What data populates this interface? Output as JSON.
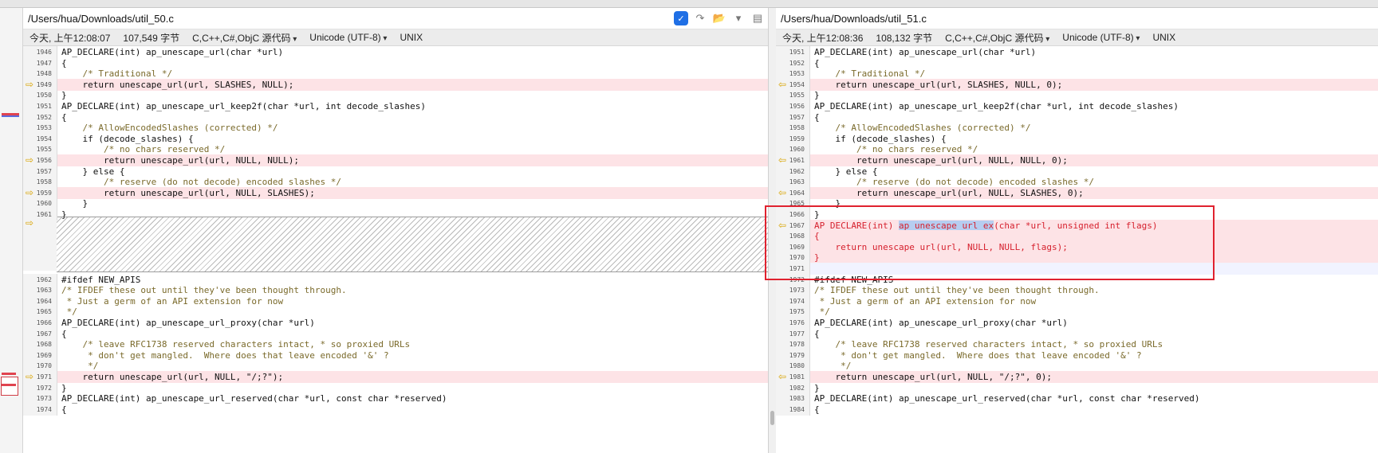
{
  "left": {
    "path": "/Users/hua/Downloads/util_50.c",
    "info": {
      "time": "今天, 上午12:08:07",
      "size": "107,549 字节",
      "syntax": "C,C++,C#,ObjC 源代码",
      "encoding": "Unicode (UTF-8)",
      "lineend": "UNIX"
    },
    "lines": [
      {
        "n": "1946",
        "t": "AP_DECLARE(int) ap_unescape_url(char *url)"
      },
      {
        "n": "1947",
        "t": "{"
      },
      {
        "n": "1948",
        "t": "    /* Traditional */"
      },
      {
        "n": "1949",
        "t": "    return unescape_url(url, SLASHES, NULL);"
      },
      {
        "n": "1950",
        "t": "}"
      },
      {
        "n": "1951",
        "t": "AP_DECLARE(int) ap_unescape_url_keep2f(char *url, int decode_slashes)"
      },
      {
        "n": "1952",
        "t": "{"
      },
      {
        "n": "1953",
        "t": "    /* AllowEncodedSlashes (corrected) */"
      },
      {
        "n": "1954",
        "t": "    if (decode_slashes) {"
      },
      {
        "n": "1955",
        "t": "        /* no chars reserved */"
      },
      {
        "n": "1956",
        "t": "        return unescape_url(url, NULL, NULL);"
      },
      {
        "n": "1957",
        "t": "    } else {"
      },
      {
        "n": "1958",
        "t": "        /* reserve (do not decode) encoded slashes */"
      },
      {
        "n": "1959",
        "t": "        return unescape_url(url, NULL, SLASHES);"
      },
      {
        "n": "1960",
        "t": "    }"
      },
      {
        "n": "1961",
        "t": "}"
      },
      {
        "n": "1962",
        "t": "#ifdef NEW_APIS"
      },
      {
        "n": "1963",
        "t": "/* IFDEF these out until they've been thought through."
      },
      {
        "n": "1964",
        "t": " * Just a germ of an API extension for now"
      },
      {
        "n": "1965",
        "t": " */"
      },
      {
        "n": "1966",
        "t": "AP_DECLARE(int) ap_unescape_url_proxy(char *url)"
      },
      {
        "n": "1967",
        "t": "{"
      },
      {
        "n": "1968",
        "t": "    /* leave RFC1738 reserved characters intact, * so proxied URLs"
      },
      {
        "n": "1969",
        "t": "     * don't get mangled.  Where does that leave encoded '&' ?"
      },
      {
        "n": "1970",
        "t": "     */"
      },
      {
        "n": "1971",
        "t": "    return unescape_url(url, NULL, \"/;?\");"
      },
      {
        "n": "1972",
        "t": "}"
      },
      {
        "n": "1973",
        "t": "AP_DECLARE(int) ap_unescape_url_reserved(char *url, const char *reserved)"
      },
      {
        "n": "1974",
        "t": "{"
      }
    ]
  },
  "right": {
    "path": "/Users/hua/Downloads/util_51.c",
    "info": {
      "time": "今天, 上午12:08:36",
      "size": "108,132 字节",
      "syntax": "C,C++,C#,ObjC 源代码",
      "encoding": "Unicode (UTF-8)",
      "lineend": "UNIX"
    },
    "lines": [
      {
        "n": "1951",
        "t": "AP_DECLARE(int) ap_unescape_url(char *url)"
      },
      {
        "n": "1952",
        "t": "{"
      },
      {
        "n": "1953",
        "t": "    /* Traditional */"
      },
      {
        "n": "1954",
        "t": "    return unescape_url(url, SLASHES, NULL, 0);"
      },
      {
        "n": "1955",
        "t": "}"
      },
      {
        "n": "1956",
        "t": "AP_DECLARE(int) ap_unescape_url_keep2f(char *url, int decode_slashes)"
      },
      {
        "n": "1957",
        "t": "{"
      },
      {
        "n": "1958",
        "t": "    /* AllowEncodedSlashes (corrected) */"
      },
      {
        "n": "1959",
        "t": "    if (decode_slashes) {"
      },
      {
        "n": "1960",
        "t": "        /* no chars reserved */"
      },
      {
        "n": "1961",
        "t": "        return unescape_url(url, NULL, NULL, 0);"
      },
      {
        "n": "1962",
        "t": "    } else {"
      },
      {
        "n": "1963",
        "t": "        /* reserve (do not decode) encoded slashes */"
      },
      {
        "n": "1964",
        "t": "        return unescape_url(url, NULL, SLASHES, 0);"
      },
      {
        "n": "1965",
        "t": "    }"
      },
      {
        "n": "1966",
        "t": "}"
      },
      {
        "n": "1967",
        "t": "AP_DECLARE(int) ap_unescape_url_ex(char *url, unsigned int flags)"
      },
      {
        "n": "1968",
        "t": "{"
      },
      {
        "n": "1969",
        "t": "    return unescape_url(url, NULL, NULL, flags);"
      },
      {
        "n": "1970",
        "t": "}"
      },
      {
        "n": "1971",
        "t": ""
      },
      {
        "n": "1972",
        "t": "#ifdef NEW_APIS"
      },
      {
        "n": "1973",
        "t": "/* IFDEF these out until they've been thought through."
      },
      {
        "n": "1974",
        "t": " * Just a germ of an API extension for now"
      },
      {
        "n": "1975",
        "t": " */"
      },
      {
        "n": "1976",
        "t": "AP_DECLARE(int) ap_unescape_url_proxy(char *url)"
      },
      {
        "n": "1977",
        "t": "{"
      },
      {
        "n": "1978",
        "t": "    /* leave RFC1738 reserved characters intact, * so proxied URLs"
      },
      {
        "n": "1979",
        "t": "     * don't get mangled.  Where does that leave encoded '&' ?"
      },
      {
        "n": "1980",
        "t": "     */"
      },
      {
        "n": "1981",
        "t": "    return unescape_url(url, NULL, \"/;?\", 0);"
      },
      {
        "n": "1982",
        "t": "}"
      },
      {
        "n": "1983",
        "t": "AP_DECLARE(int) ap_unescape_url_reserved(char *url, const char *reserved)"
      },
      {
        "n": "1984",
        "t": "{"
      }
    ]
  },
  "icons": [
    "dropdown-check-icon",
    "merge-icon",
    "folder-icon",
    "chevron-down-icon",
    "save-icon",
    "diff-arrow-icon"
  ],
  "colors": {
    "changed_bg": "#fde3e6",
    "added_text": "#d6212e",
    "arrow": "#d9a400",
    "highlight": "#b6cdf0",
    "frame": "#e0222f"
  }
}
